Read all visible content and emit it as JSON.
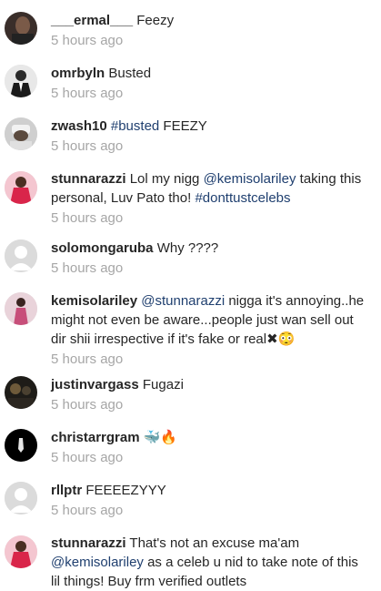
{
  "comments": [
    {
      "user": "___ermal___",
      "parts": [
        {
          "t": "Feezy"
        }
      ],
      "time": "5 hours ago",
      "avatar": "photo-dark-person"
    },
    {
      "user": "omrbyln",
      "parts": [
        {
          "t": "Busted"
        }
      ],
      "time": "5 hours ago",
      "avatar": "photo-suit"
    },
    {
      "user": "zwash10",
      "parts": [
        {
          "t": "#busted",
          "tag": true
        },
        {
          "t": " FEEZY"
        }
      ],
      "time": "5 hours ago",
      "avatar": "photo-hat"
    },
    {
      "user": "stunnarazzi",
      "parts": [
        {
          "t": "Lol my nigg "
        },
        {
          "t": "@kemisolariley",
          "tag": true
        },
        {
          "t": " taking this personal, Luv Pato tho! "
        },
        {
          "t": "#donttustcelebs",
          "tag": true
        }
      ],
      "time": "5 hours ago",
      "avatar": "photo-woman-red"
    },
    {
      "user": "solomongaruba",
      "parts": [
        {
          "t": "Why ????"
        }
      ],
      "time": "5 hours ago",
      "avatar": "default-avatar"
    },
    {
      "user": "kemisolariley",
      "parts": [
        {
          "t": "@stunnarazzi",
          "tag": true
        },
        {
          "t": " nigga it's annoying..he might not even be aware...people just wan sell out dir shii irrespective if it's fake or real✖😳"
        }
      ],
      "time": "5 hours ago",
      "avatar": "photo-woman-pink"
    },
    {
      "user": "justinvargass",
      "parts": [
        {
          "t": "Fugazi"
        }
      ],
      "time": "5 hours ago",
      "avatar": "photo-dark-scene"
    },
    {
      "user": "christarrgram",
      "parts": [
        {
          "t": "🐳🔥"
        }
      ],
      "time": "5 hours ago",
      "avatar": "photo-black-logo"
    },
    {
      "user": "rllptr",
      "parts": [
        {
          "t": "FEEEEZYYY"
        }
      ],
      "time": "5 hours ago",
      "avatar": "default-avatar"
    },
    {
      "user": "stunnarazzi",
      "parts": [
        {
          "t": "That's not an excuse ma'am "
        },
        {
          "t": "@kemisolariley",
          "tag": true
        },
        {
          "t": " as a celeb u nid to take note of this lil things! Buy frm verified outlets"
        }
      ],
      "time": "",
      "avatar": "photo-woman-red"
    }
  ],
  "colors": {
    "tag": "#1f3f6f",
    "time": "#a6a6a6",
    "text": "#262626"
  }
}
